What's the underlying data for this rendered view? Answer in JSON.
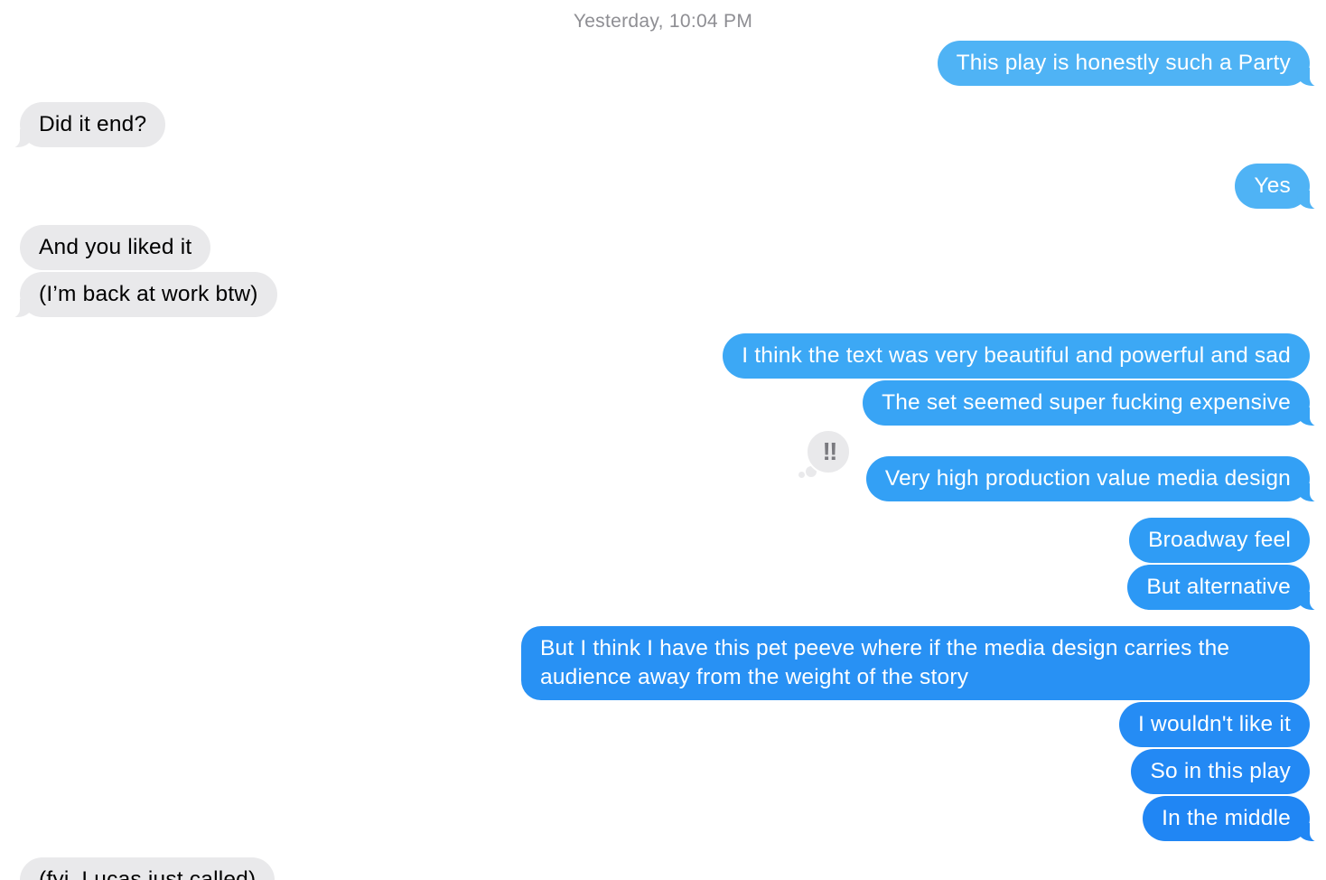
{
  "conversation": {
    "timestamp": "Yesterday, 10:04 PM",
    "messages": [
      {
        "text": "This play is honestly such a Party",
        "from": "me",
        "color": "#4fb3f5"
      },
      {
        "text": "Did it end?",
        "from": "them"
      },
      {
        "text": "Yes",
        "from": "me",
        "color": "#4fb3f5"
      },
      {
        "text": "And you liked it",
        "from": "them"
      },
      {
        "text": "(I’m back at work btw)",
        "from": "them"
      },
      {
        "text": "I think the text was very beautiful and powerful and sad",
        "from": "me",
        "color": "#3ca8f5"
      },
      {
        "text": "The set seemed super fucking expensive",
        "from": "me",
        "color": "#38a4f5"
      },
      {
        "text": "Very high production value media design",
        "from": "me",
        "color": "#33a0f5",
        "tapback": "‼"
      },
      {
        "text": "Broadway feel",
        "from": "me",
        "color": "#2f9cf5"
      },
      {
        "text": "But alternative",
        "from": "me",
        "color": "#2c98f5"
      },
      {
        "text": "But I think I have this pet peeve where if the media design carries the audience away from the weight of the story",
        "from": "me",
        "color": "#2891f4"
      },
      {
        "text": "I wouldn't like it",
        "from": "me",
        "color": "#258cf4"
      },
      {
        "text": "So in this play",
        "from": "me",
        "color": "#2389f4"
      },
      {
        "text": "In the middle",
        "from": "me",
        "color": "#2086f4"
      },
      {
        "text": "(fyi, Lucas just called)",
        "from": "them"
      }
    ]
  },
  "theme": {
    "incoming_bubble": "#e9e9eb",
    "timestamp_color": "#8e8e93"
  }
}
